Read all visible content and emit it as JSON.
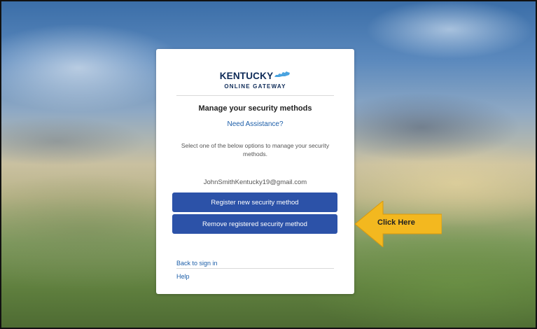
{
  "logo": {
    "main": "KENTUCKY",
    "sub": "ONLINE GATEWAY"
  },
  "form": {
    "title": "Manage your security methods",
    "assistance_link": "Need Assistance?",
    "instructions": "Select one of the below options to manage your security methods.",
    "email": "JohnSmithKentucky19@gmail.com",
    "register_button": "Register new security method",
    "remove_button": "Remove registered security method",
    "back_link": "Back to sign in",
    "help_link": "Help"
  },
  "callout": {
    "text": "Click Here",
    "color": "#f3b81f"
  },
  "colors": {
    "primary_button": "#2c52a8",
    "link": "#1c5ea8",
    "logo": "#0e2b58",
    "state_shape": "#4aa3df"
  }
}
